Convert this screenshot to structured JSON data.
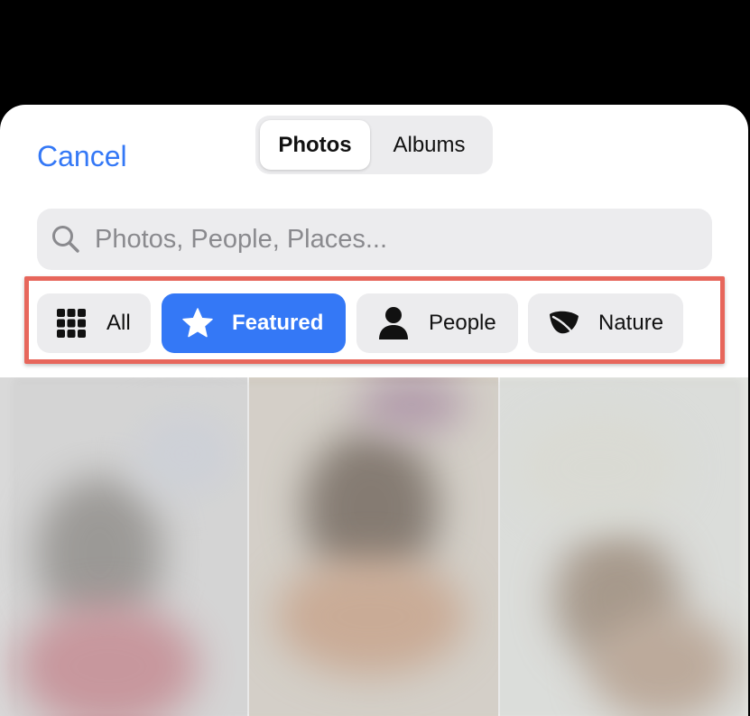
{
  "header": {
    "cancel_label": "Cancel",
    "tabs": [
      {
        "label": "Photos",
        "selected": true
      },
      {
        "label": "Albums",
        "selected": false
      }
    ]
  },
  "search": {
    "placeholder": "Photos, People, Places...",
    "value": "",
    "icon": "search-icon"
  },
  "filters": {
    "highlight_color": "#e7665b",
    "accent_color": "#3478f6",
    "chips": [
      {
        "label": "All",
        "icon": "grid-icon",
        "selected": false
      },
      {
        "label": "Featured",
        "icon": "star-icon",
        "selected": true
      },
      {
        "label": "People",
        "icon": "person-icon",
        "selected": false
      },
      {
        "label": "Nature",
        "icon": "leaf-icon",
        "selected": false
      }
    ]
  },
  "photos": {
    "blurred": true,
    "count_visible": 3
  }
}
